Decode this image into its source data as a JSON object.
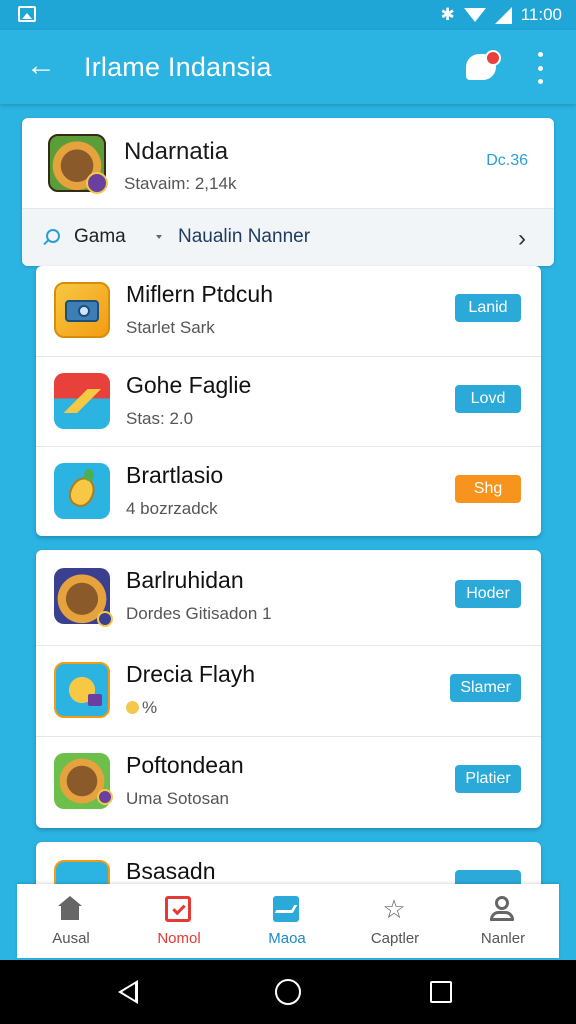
{
  "status_bar": {
    "time": "11:00"
  },
  "app_bar": {
    "title": "Irlame Indansia"
  },
  "header": {
    "name": "Ndarnatia",
    "subtitle": "Stavaim: 2,14k",
    "date": "Dc.36",
    "filter_label": "Gama",
    "sort_label": "Naualin Nanner"
  },
  "groups": [
    {
      "rows": [
        {
          "title": "Miflern Ptdcuh",
          "meta": "Starlet Sark",
          "button": "Lanid",
          "button_color": "#2ba9d9",
          "icon": "camera-app-icon"
        },
        {
          "title": "Gohe Faglie",
          "meta": "Stas: 2.0",
          "button": "Lovd",
          "button_color": "#2ba9d9",
          "icon": "chart-app-icon"
        },
        {
          "title": "Brartlasio",
          "meta": "4 bozrzadck",
          "button": "Shg",
          "button_color": "#f7941d",
          "icon": "carrot-app-icon"
        }
      ]
    },
    {
      "rows": [
        {
          "title": "Barlruhidan",
          "meta": "Dordes Gitisadon 1",
          "button": "Hoder",
          "button_color": "#2ba9d9",
          "icon": "monkey-app-icon"
        },
        {
          "title": "Drecia Flayh",
          "meta": "%",
          "button": "Slamer",
          "button_color": "#2ba9d9",
          "icon": "bird-app-icon"
        },
        {
          "title": "Poftondean",
          "meta": "Uma Sotosan",
          "button": "Platier",
          "button_color": "#2ba9d9",
          "icon": "monkey-game-icon"
        }
      ]
    },
    {
      "rows": [
        {
          "title": "Bsasadn",
          "meta": "",
          "button": "",
          "button_color": "#2ba9d9",
          "icon": "game-app-icon"
        }
      ]
    }
  ],
  "bottom_nav": [
    {
      "label": "Ausal",
      "icon": "home-icon",
      "color": "#666666"
    },
    {
      "label": "Nomol",
      "icon": "checklist-icon",
      "color": "#e53935"
    },
    {
      "label": "Maoa",
      "icon": "graph-icon",
      "color": "#1e88c8"
    },
    {
      "label": "Captler",
      "icon": "star-icon",
      "color": "#666666"
    },
    {
      "label": "Nanler",
      "icon": "person-icon",
      "color": "#666666"
    }
  ]
}
